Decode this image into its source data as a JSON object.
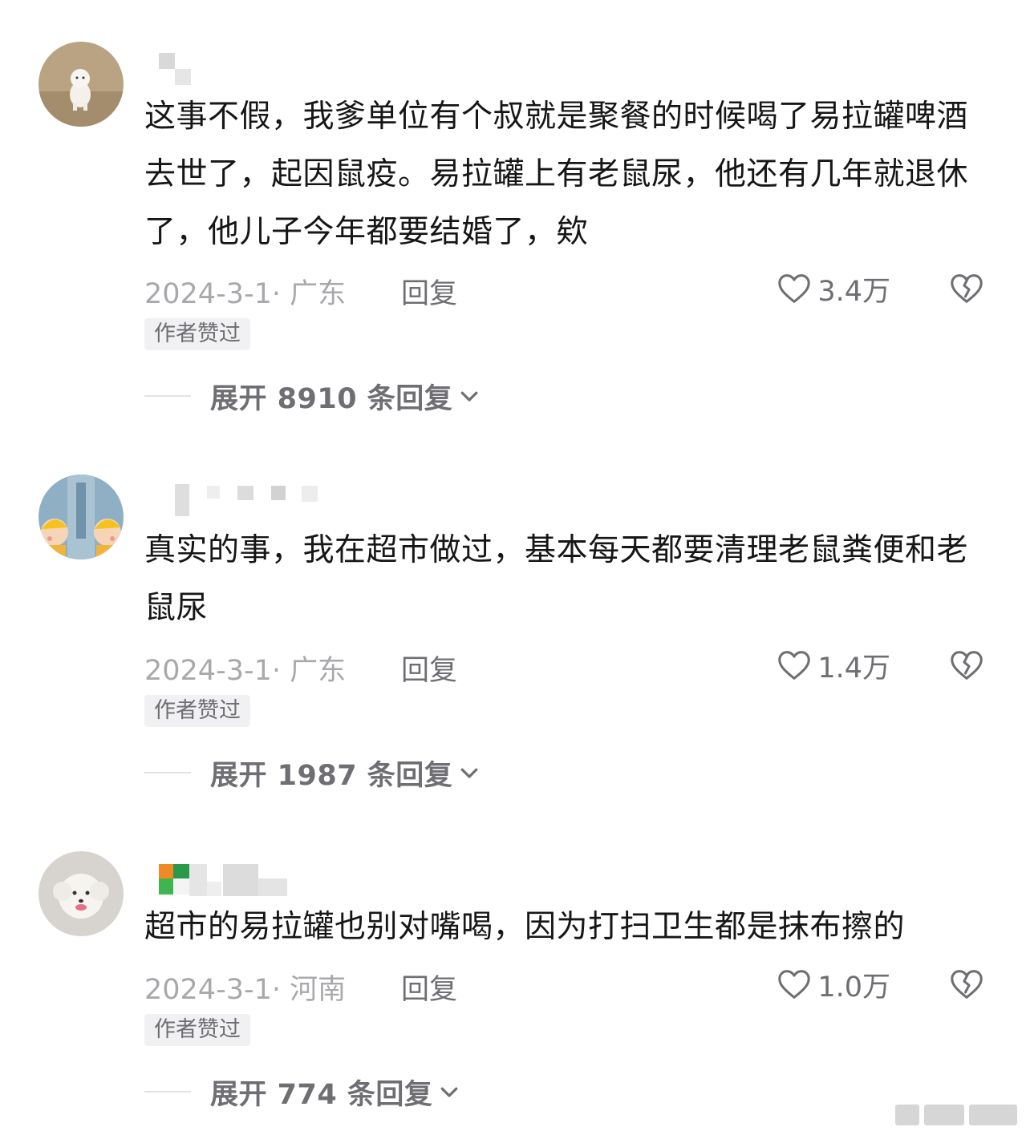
{
  "comments": [
    {
      "content": "这事不假，我爹单位有个叔就是聚餐的时候喝了易拉罐啤酒去世了，起因鼠疫。易拉罐上有老鼠尿，他还有几年就退休了，他儿子今年都要结婚了，欸",
      "meta": "2024-3-1· 广东",
      "reply_label": "回复",
      "like_count": "3.4万",
      "badge": "作者赞过",
      "expand_label": "展开 8910 条回复"
    },
    {
      "content": "真实的事，我在超市做过，基本每天都要清理老鼠粪便和老鼠尿",
      "meta": "2024-3-1· 广东",
      "reply_label": "回复",
      "like_count": "1.4万",
      "badge": "作者赞过",
      "expand_label": "展开 1987 条回复"
    },
    {
      "content": "超市的易拉罐也别对嘴喝，因为打扫卫生都是抹布擦的",
      "meta": "2024-3-1· 河南",
      "reply_label": "回复",
      "like_count": "1.0万",
      "badge": "作者赞过",
      "expand_label": "展开 774 条回复"
    }
  ],
  "icons": {
    "like": "heart-outline-icon",
    "dislike": "broken-heart-icon",
    "expand": "chevron-down-icon"
  },
  "colors": {
    "text": "#161616",
    "meta": "#a9a9ad",
    "secondary": "#6e6e73",
    "badge_bg": "#f1f1f3"
  }
}
